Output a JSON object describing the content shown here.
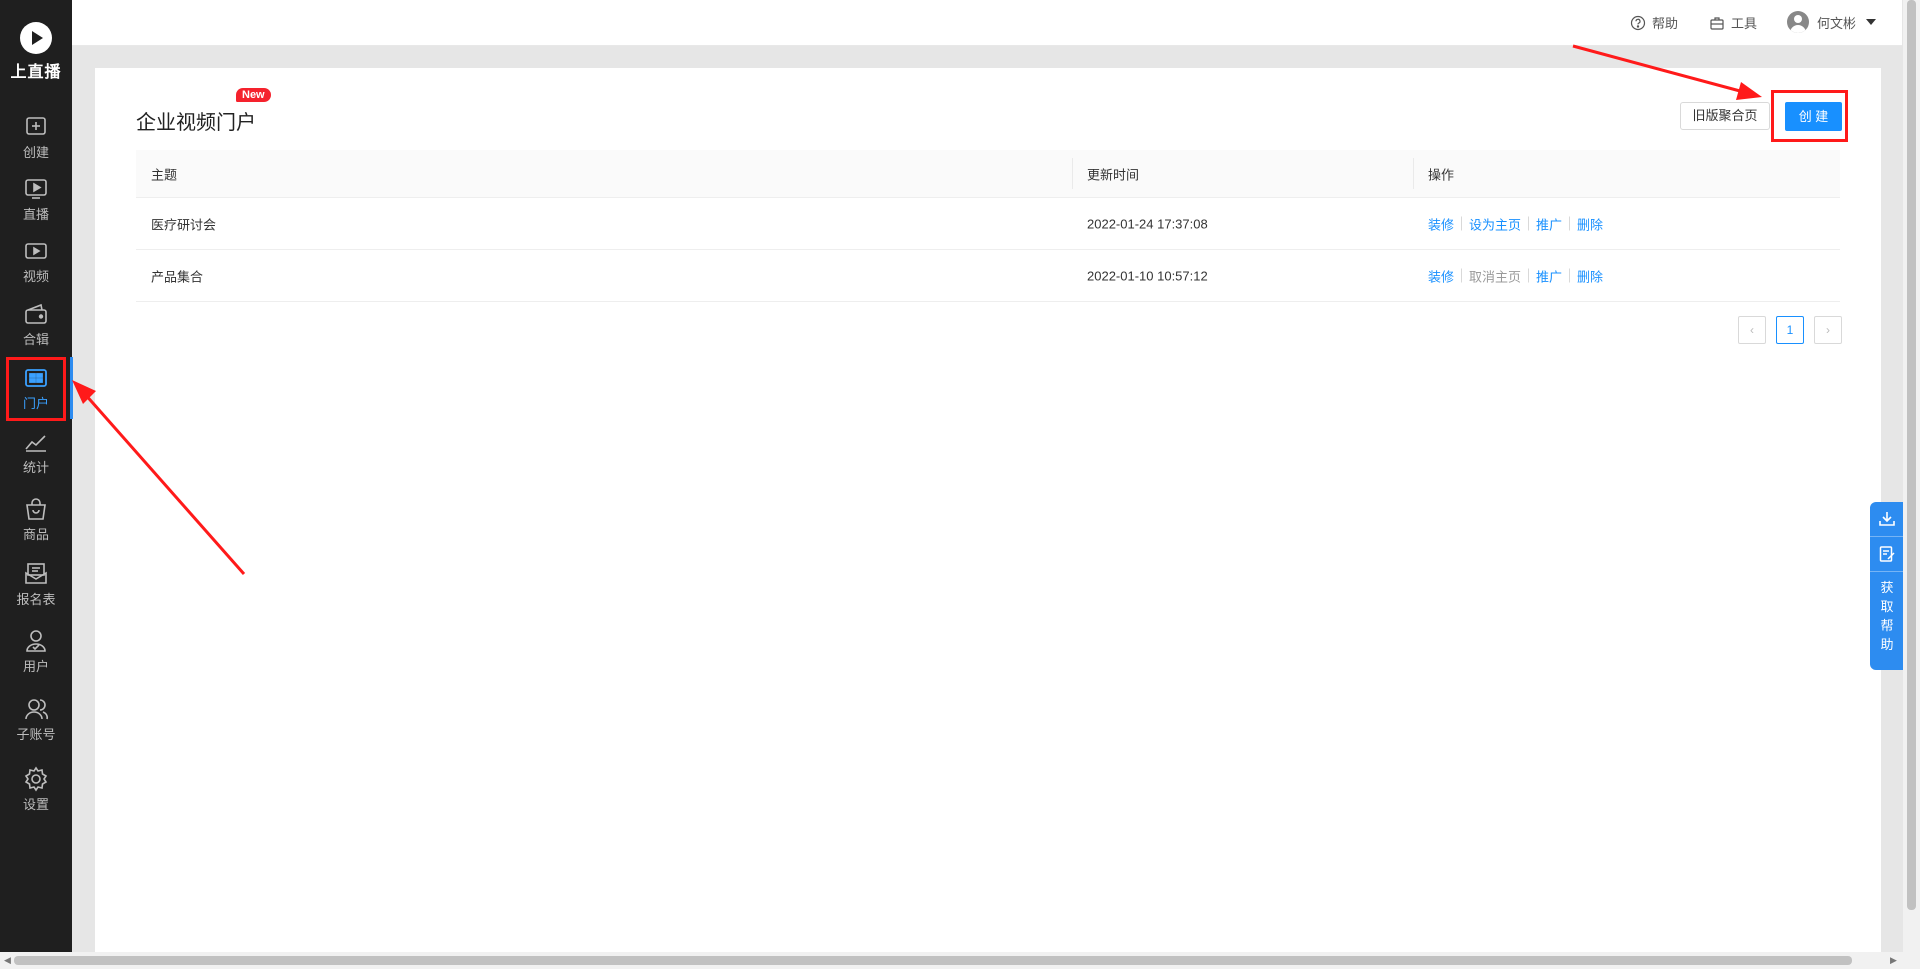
{
  "app": {
    "logo_text": "上直播"
  },
  "sidebar": {
    "items": [
      {
        "label": "创建",
        "icon": "plus-square-icon"
      },
      {
        "label": "直播",
        "icon": "live-play-icon"
      },
      {
        "label": "视频",
        "icon": "video-icon"
      },
      {
        "label": "合辑",
        "icon": "wallet-icon"
      },
      {
        "label": "门户",
        "icon": "portal-grid-icon",
        "active": true
      },
      {
        "label": "统计",
        "icon": "line-chart-icon"
      },
      {
        "label": "商品",
        "icon": "shopping-bag-icon"
      },
      {
        "label": "报名表",
        "icon": "form-icon"
      },
      {
        "label": "用户",
        "icon": "user-check-icon"
      },
      {
        "label": "子账号",
        "icon": "sub-account-icon"
      },
      {
        "label": "设置",
        "icon": "gear-icon"
      }
    ]
  },
  "topbar": {
    "help": "帮助",
    "tools": "工具",
    "username": "何文彬"
  },
  "page": {
    "title": "企业视频门户",
    "new_badge": "New",
    "old_button": "旧版聚合页",
    "create_button": "创 建"
  },
  "table": {
    "headers": [
      "主题",
      "更新时间",
      "操作"
    ],
    "rows": [
      {
        "subject": "医疗研讨会",
        "updated": "2022-01-24 17:37:08",
        "actions": [
          "装修",
          "设为主页",
          "推广",
          "删除"
        ],
        "disabled": [
          false,
          false,
          false,
          false
        ]
      },
      {
        "subject": "产品集合",
        "updated": "2022-01-10 10:57:12",
        "actions": [
          "装修",
          "取消主页",
          "推广",
          "删除"
        ],
        "disabled": [
          false,
          true,
          false,
          false
        ]
      }
    ]
  },
  "pagination": {
    "prev": "‹",
    "current": "1",
    "next": "›"
  },
  "help_panel": {
    "label": "获取帮助"
  },
  "colors": {
    "accent": "#1890ff",
    "sidebar_bg": "#1f1f1f",
    "annotation_red": "#ff1a1a"
  }
}
